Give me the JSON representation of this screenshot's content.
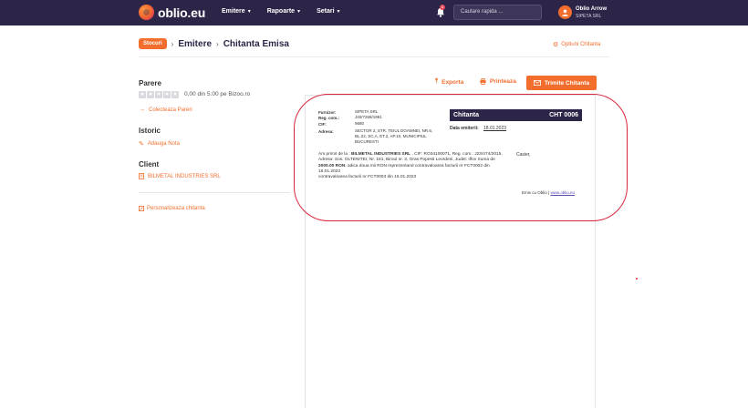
{
  "nav": {
    "logo": "oblio.eu",
    "menu": [
      {
        "label": "Emitere"
      },
      {
        "label": "Rapoarte"
      },
      {
        "label": "Setari"
      }
    ],
    "notification_count": "1",
    "search_placeholder": "Cautare rapida ...",
    "user_name": "Oblio Arrow",
    "user_company": "SIPETA SRL"
  },
  "breadcrumb": {
    "badge": "Stocuri",
    "level1": "Emitere",
    "level2": "Chitanta Emisa",
    "options": "Optiuni Chitanta"
  },
  "sidebar": {
    "parere_title": "Parere",
    "rating_text": "0.00 din 5.00 pe Bizoo.ro",
    "rating_value": 0,
    "collect_reviews": "Colecteaza Pareri",
    "istoric_title": "Istoric",
    "add_note": "Adauga Nota",
    "client_title": "Client",
    "client_name": "BILMETAL INDUSTRIES SRL",
    "customize": "Personalizeaza chitanta"
  },
  "actions": {
    "export": "Exporta",
    "print": "Printeaza",
    "send": "Trimite Chitanta"
  },
  "document": {
    "supplier_label": "Furnizor:",
    "supplier_value": "SIPETA SRL",
    "reg_label": "Reg. com.:",
    "reg_value": "J40/7268/1991",
    "cif_label": "CIF:",
    "cif_value": "9680",
    "address_label": "Adresa:",
    "address_value": "SECTOR 2, STR. TEIUL DOAMNEI, NR.6, BL.22, SC.A, ET.2, AP.10, MUNICIPIUL BUCURESTI",
    "title": "Chitanta",
    "number": "CHT 0006",
    "date_label": "Data emiterii:",
    "date_value": "18.01.2023",
    "body_prefix": "Am primit de la : ",
    "body_client": "BILMETAL INDUSTRIES SRL",
    "body_mid1": " , CIF: RO34100071, Reg. com.: J23/474/2015, Adresa: Sos. OLTENITEI, Nr. 181, Biroul nr. 3, Oras Popesti Leordeni, Judet: Ilfov Suma de ",
    "body_amount": "2000.00 RON",
    "body_mid2": ", adica doua mii RON reprezentand contravaloarea facturii nr FCT0002 din 16.01.2023",
    "body_line2": "contravaloarea facturii nr FCT0003 din 16.01.2023",
    "cashier": "Casier,",
    "footer_prefix": "Emis cu Oblio | ",
    "footer_link": "www.oblio.eu"
  }
}
